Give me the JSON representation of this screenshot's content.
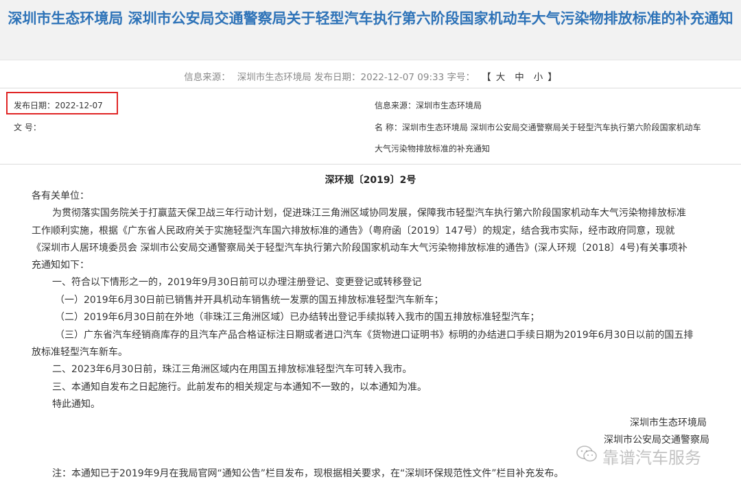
{
  "title": "深圳市生态环境局 深圳市公安局交通警察局关于轻型汽车执行第六阶段国家机动车大气污染物排放标准的补充通知",
  "meta": {
    "source_label": "信息来源：",
    "source_value": "深圳市生态环境局",
    "date_label": "发布日期：",
    "date_value": "2022-12-07 09:33",
    "fontsize_label": "字号：",
    "font_large": "大",
    "font_medium": "中",
    "font_small": "小",
    "bracket_open": "【",
    "bracket_close": "】"
  },
  "info": {
    "publish_date": "发布日期：2022-12-07",
    "doc_label": "文  号：",
    "source": "信息来源：深圳市生态环境局",
    "name_line1": "名  称：深圳市生态环境局 深圳市公安局交通警察局关于轻型汽车执行第六阶段国家机动车",
    "name_line2": "大气污染物排放标准的补充通知"
  },
  "doc_number": "深环规〔2019〕2号",
  "body": {
    "salutation": "各有关单位：",
    "lines": [
      "为贯彻落实国务院关于打赢蓝天保卫战三年行动计划，促进珠江三角洲区域协同发展，保障我市轻型汽车执行第六阶段国家机动车大气污染物排放标准",
      "工作顺利实施，根据《广东省人民政府关于实施轻型汽车国六排放标准的通告》（粤府函〔2019〕147号）的规定，结合我市实际，经市政府同意，现就",
      "《深圳市人居环境委员会 深圳市公安局交通警察局关于轻型汽车执行第六阶段国家机动车大气污染物排放标准的通告》(深人环规〔2018〕4号)有关事项补",
      "充通知如下：",
      "一、符合以下情形之一的，2019年9月30日前可以办理注册登记、变更登记或转移登记",
      "（一）2019年6月30日前已销售并开具机动车销售统一发票的国五排放标准轻型汽车新车；",
      "（二）2019年6月30日前在外地（非珠江三角洲区域）已办结转出登记手续拟转入我市的国五排放标准轻型汽车；",
      "（三）广东省汽车经销商库存的且汽车产品合格证标注日期或者进口汽车《货物进口证明书》标明的办结进口手续日期为2019年6月30日以前的国五排",
      "放标准轻型汽车新车。",
      "二、2023年6月30日前，珠江三角洲区域内在用国五排放标准轻型汽车可转入我市。",
      "三、本通知自发布之日起施行。此前发布的相关规定与本通知不一致的，以本通知为准。",
      "特此通知。"
    ]
  },
  "signers": [
    "深圳市生态环境局",
    "深圳市公安局交通警察局"
  ],
  "footnote": "注：本通知已于2019年9月在我局官网“通知公告”栏目发布，现根据相关要求，在“深圳环保规范性文件”栏目补充发布。",
  "watermark": "靠谱汽车服务",
  "colors": {
    "title": "#2e73b8",
    "highlight_box": "#e02424",
    "meta_text": "#888888"
  }
}
